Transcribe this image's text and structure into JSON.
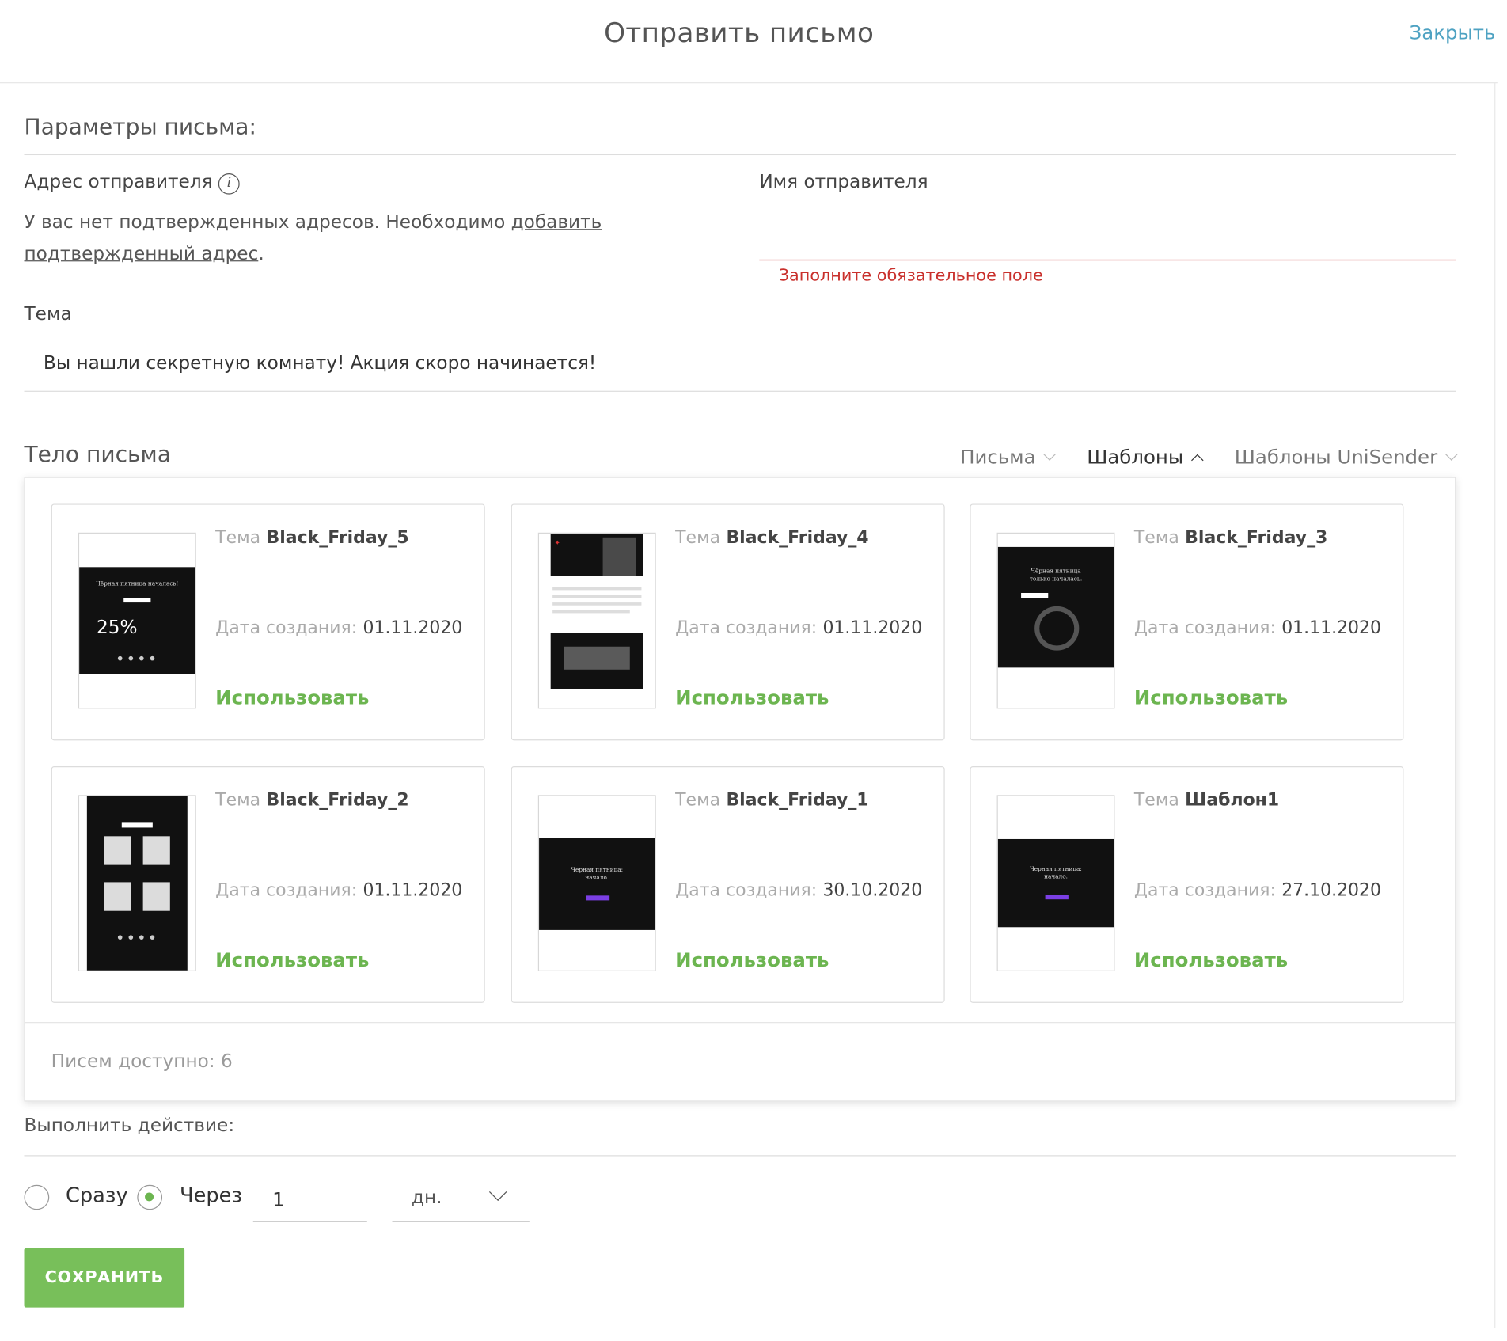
{
  "header": {
    "title": "Отправить письмо",
    "close_label": "Закрыть"
  },
  "params": {
    "section_title": "Параметры письма:",
    "sender_address": {
      "label": "Адрес отправителя",
      "notice_before": "У вас нет подтвержденных адресов. Необходимо ",
      "notice_link": "добавить подтвержденный адрес",
      "notice_after": "."
    },
    "sender_name": {
      "label": "Имя отправителя",
      "value": "",
      "error": "Заполните обязательное поле"
    },
    "subject": {
      "label": "Тема",
      "value": "Вы нашли секретную комнату! Акция скоро начинается!"
    }
  },
  "body": {
    "section_title": "Тело письма",
    "tabs": [
      {
        "label": "Письма",
        "active": false
      },
      {
        "label": "Шаблоны",
        "active": true
      },
      {
        "label": "Шаблоны UniSender",
        "active": false
      }
    ],
    "subject_key": "Тема",
    "date_key": "Дата создания:",
    "use_label": "Использовать",
    "templates": [
      {
        "name": "Black_Friday_5",
        "date": "01.11.2020",
        "thumb_text": "25%"
      },
      {
        "name": "Black_Friday_4",
        "date": "01.11.2020"
      },
      {
        "name": "Black_Friday_3",
        "date": "01.11.2020"
      },
      {
        "name": "Black_Friday_2",
        "date": "01.11.2020"
      },
      {
        "name": "Black_Friday_1",
        "date": "30.10.2020"
      },
      {
        "name": "Шаблон1",
        "date": "27.10.2020"
      }
    ],
    "count_text": "Писем доступно: 6"
  },
  "action": {
    "section_title": "Выполнить действие:",
    "option_now": "Сразу",
    "option_after": "Через",
    "selected": "after",
    "delay_value": "1",
    "unit": "дн."
  },
  "save_label": "СОХРАНИТЬ",
  "colors": {
    "accent_green": "#78bf5a",
    "link_blue": "#4ea2c2",
    "error_red": "#c9302c"
  }
}
